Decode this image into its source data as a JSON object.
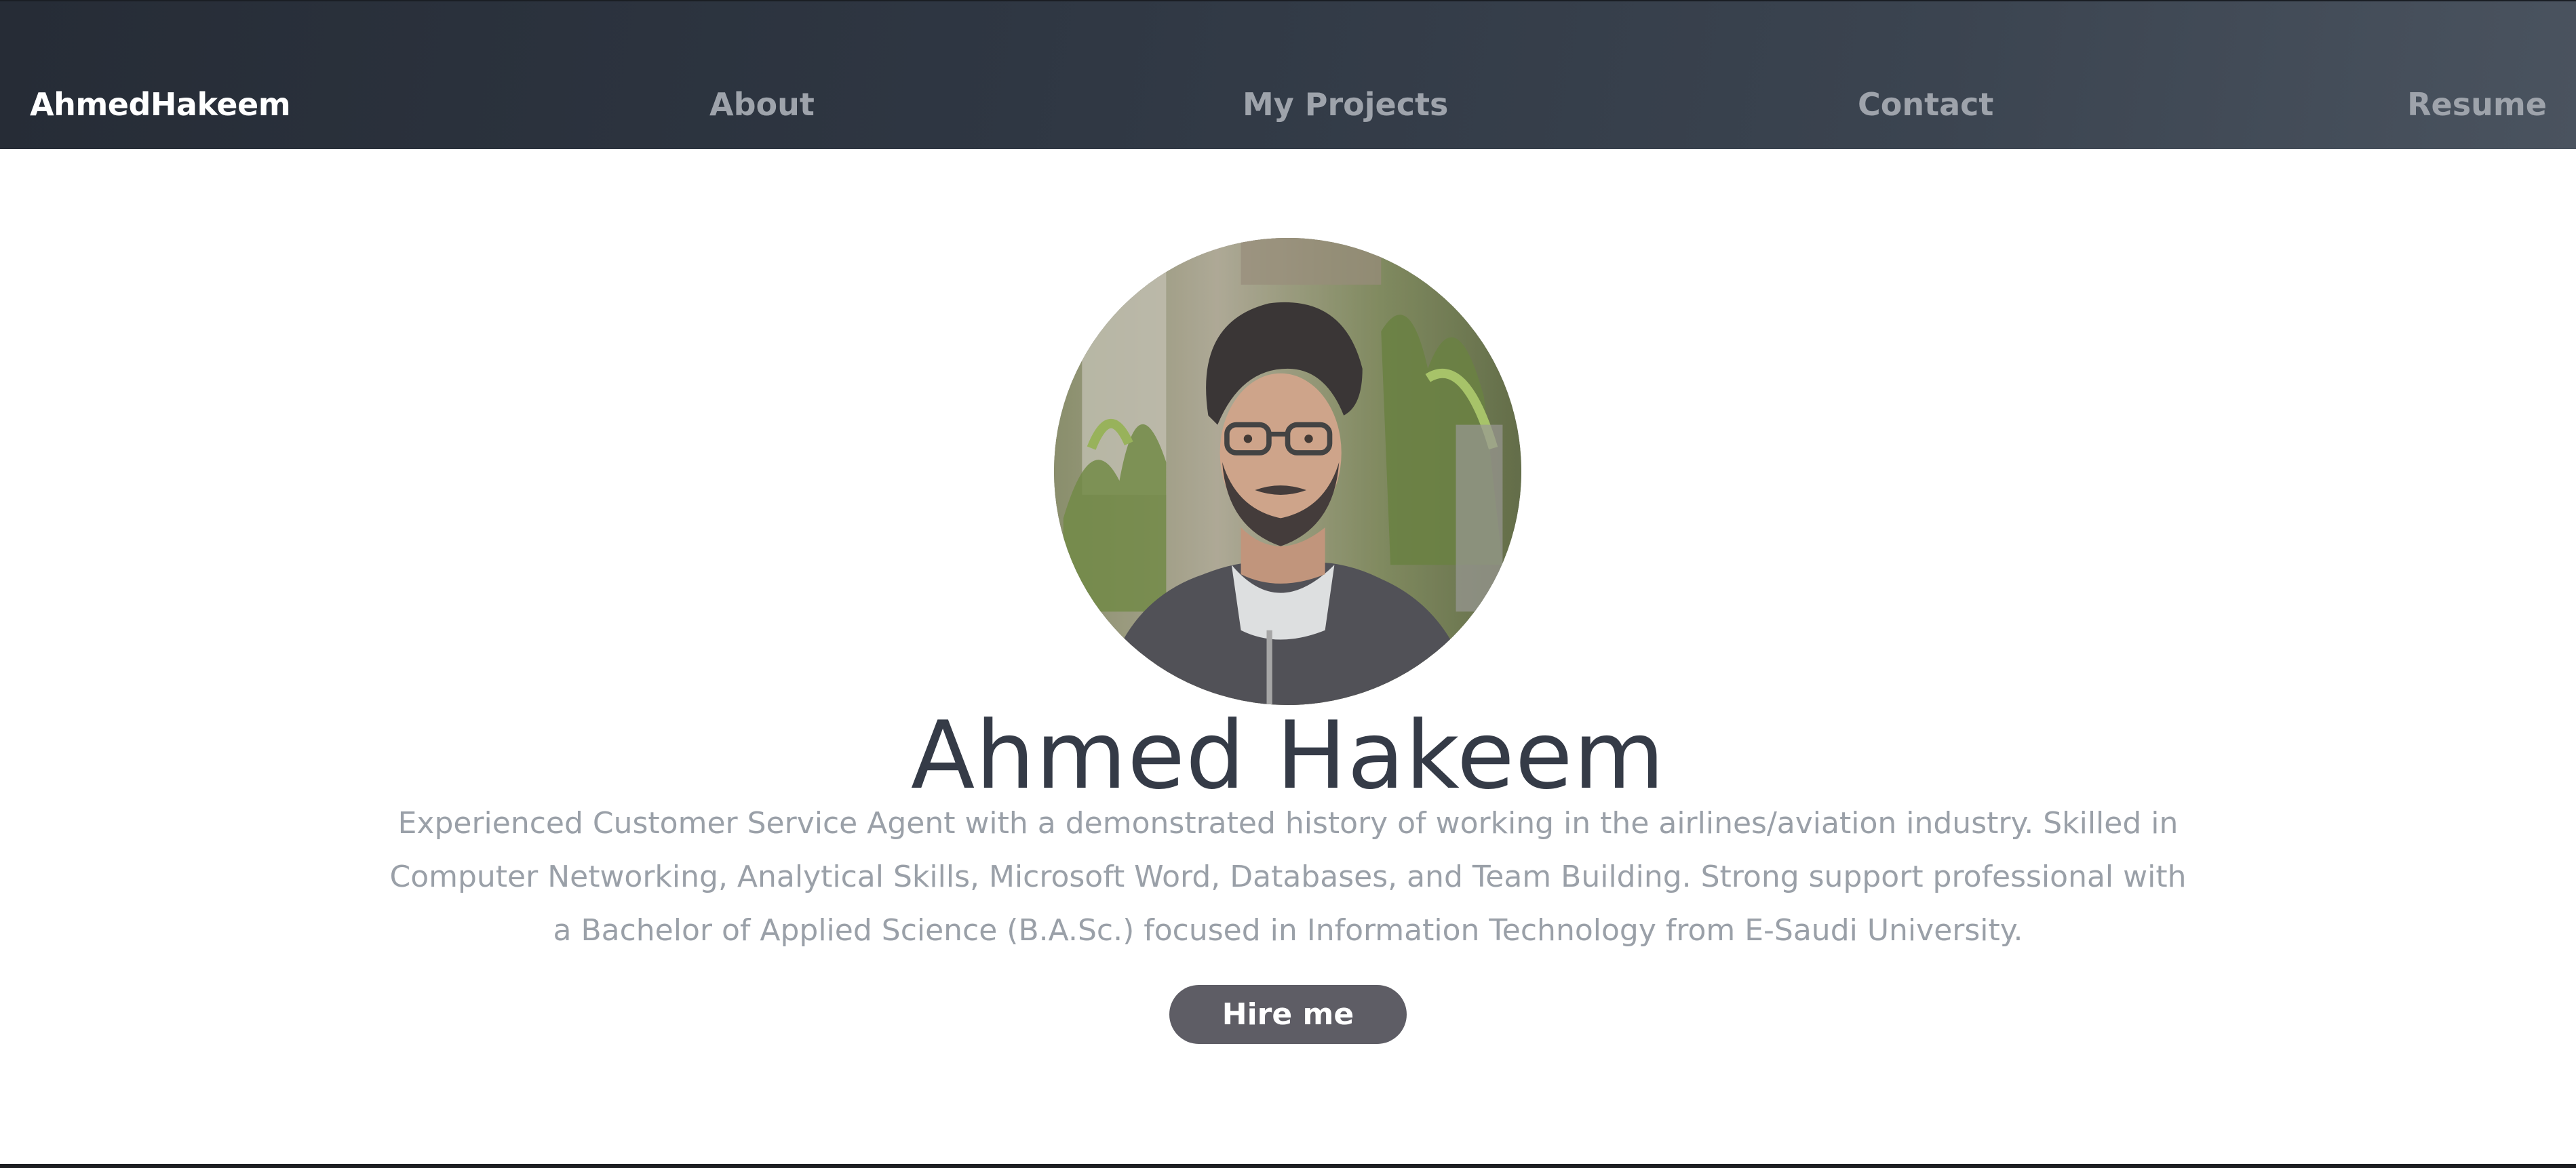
{
  "navbar": {
    "brand": "AhmedHakeem",
    "links": [
      {
        "label": "About"
      },
      {
        "label": "My Projects"
      },
      {
        "label": "Contact"
      },
      {
        "label": "Resume"
      }
    ],
    "link_color": "#9ea3ab",
    "brand_color": "#ffffff"
  },
  "hero": {
    "avatar_icon": "profile-photo",
    "name": "Ahmed Hakeem",
    "bio": "Experienced Customer Service Agent with a demonstrated history of working in the airlines/aviation industry. Skilled in Computer Networking, Analytical Skills, Microsoft Word, Databases, and Team Building. Strong support professional with a Bachelor of Applied Science (B.A.Sc.) focused in Information Technology from E-Saudi University.",
    "cta_label": "Hire me",
    "cta_color": "#5e5d65"
  }
}
